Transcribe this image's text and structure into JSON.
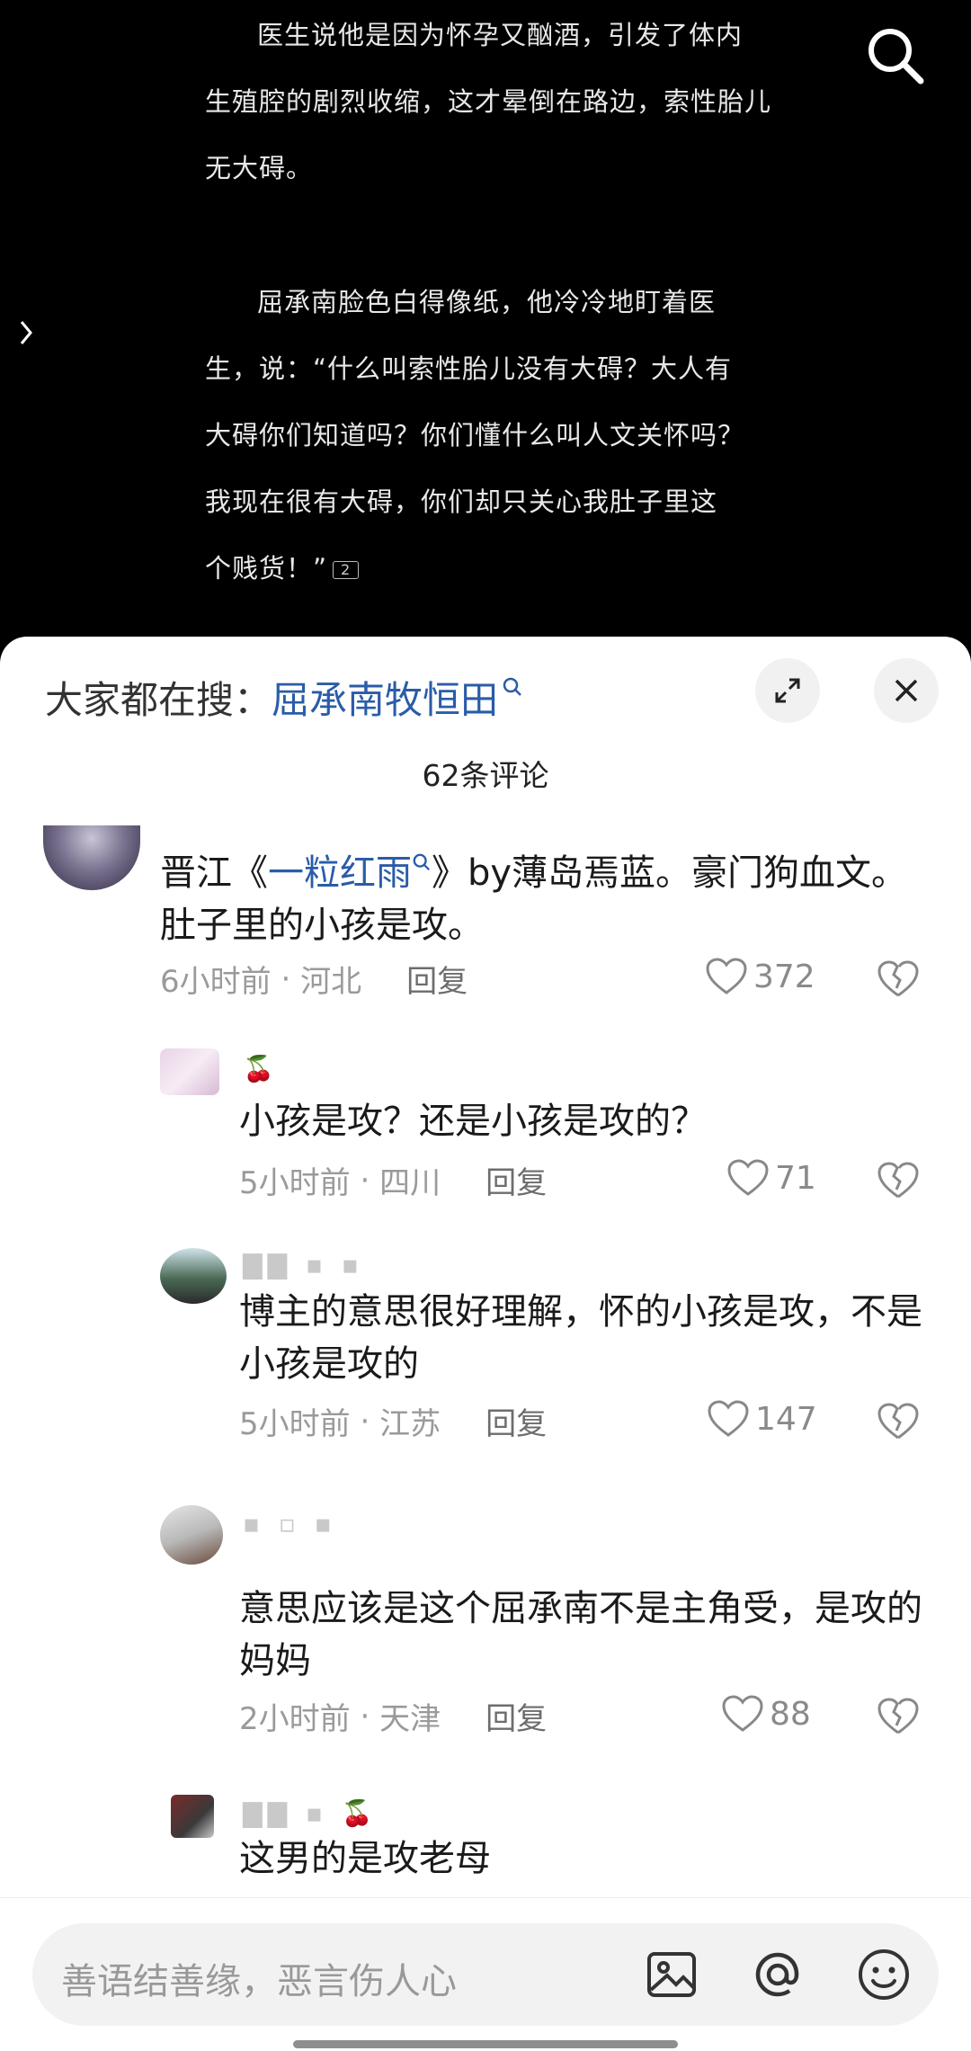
{
  "reader": {
    "paragraph1": "医生说他是因为怀孕又酗酒，引发了体内生殖腔的剧烈收缩，这才晕倒在路边，索性胎儿无大碍。",
    "paragraph1_lines": [
      "医生说他是因为怀孕又酗酒，引发了体内",
      "生殖腔的剧烈收缩，这才晕倒在路边，索性胎儿",
      "无大碍。"
    ],
    "paragraph2_lines": [
      "屈承南脸色白得像纸，他冷冷地盯着医",
      "生，说：“什么叫索性胎儿没有大碍？大人有",
      "大碍你们知道吗？你们懂什么叫人文关怀吗？",
      "我现在很有大碍，你们却只关心我肚子里这",
      "个贱货！”"
    ],
    "note_count": "2"
  },
  "sheet": {
    "hot_search_label": "大家都在搜：",
    "hot_search_term": "屈承南牧恒田",
    "comment_count": "62条评论"
  },
  "comments": [
    {
      "text_prefix": "晋江《",
      "text_link": "一粒红雨",
      "text_suffix": "》by薄岛焉蓝。豪门狗血文。肚子里的小孩是攻。",
      "time": "6小时前",
      "location": "河北",
      "reply": "回复",
      "likes": "372"
    },
    {
      "text": "小孩是攻？还是小孩是攻的？",
      "time": "5小时前",
      "location": "四川",
      "reply": "回复",
      "likes": "71"
    },
    {
      "text": "博主的意思很好理解，怀的小孩是攻，不是小孩是攻的",
      "time": "5小时前",
      "location": "江苏",
      "reply": "回复",
      "likes": "147"
    },
    {
      "text": "意思应该是这个屈承南不是主角受，是攻的妈妈",
      "time": "2小时前",
      "location": "天津",
      "reply": "回复",
      "likes": "88"
    },
    {
      "text": "这男的是攻老母"
    }
  ],
  "bottom_bar": {
    "placeholder": "善语结善缘，恶言伤人心",
    "icons": [
      "image-icon",
      "at-icon",
      "emoji-icon"
    ]
  },
  "colors": {
    "link": "#2a5ca8",
    "sheet_bg": "#ffffff",
    "reader_bg": "#000000"
  }
}
